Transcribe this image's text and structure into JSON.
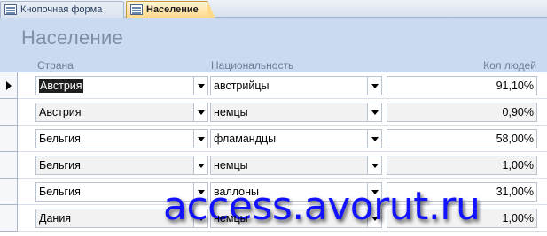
{
  "tabs": [
    {
      "label": "Кнопочная форма",
      "icon": "form-icon"
    },
    {
      "label": "Население",
      "icon": "form-icon",
      "active": true
    }
  ],
  "form": {
    "title": "Население",
    "columns": {
      "country": "Страна",
      "nationality": "Национальность",
      "people": "Кол людей"
    }
  },
  "rows": [
    {
      "country": "Австрия",
      "nationality": "австрийцы",
      "people": "91,10%"
    },
    {
      "country": "Австрия",
      "nationality": "немцы",
      "people": "0,90%"
    },
    {
      "country": "Бельгия",
      "nationality": "фламандцы",
      "people": "58,00%"
    },
    {
      "country": "Бельгия",
      "nationality": "немцы",
      "people": "1,00%"
    },
    {
      "country": "Бельгия",
      "nationality": "валлоны",
      "people": "31,00%"
    },
    {
      "country": "Дания",
      "nationality": "немцы",
      "people": "1,00%"
    }
  ],
  "watermark": "access.avorut.ru",
  "colors": {
    "header": "#c9daf1",
    "active_tab": "#ffd98a",
    "watermark": "#1212ff"
  }
}
